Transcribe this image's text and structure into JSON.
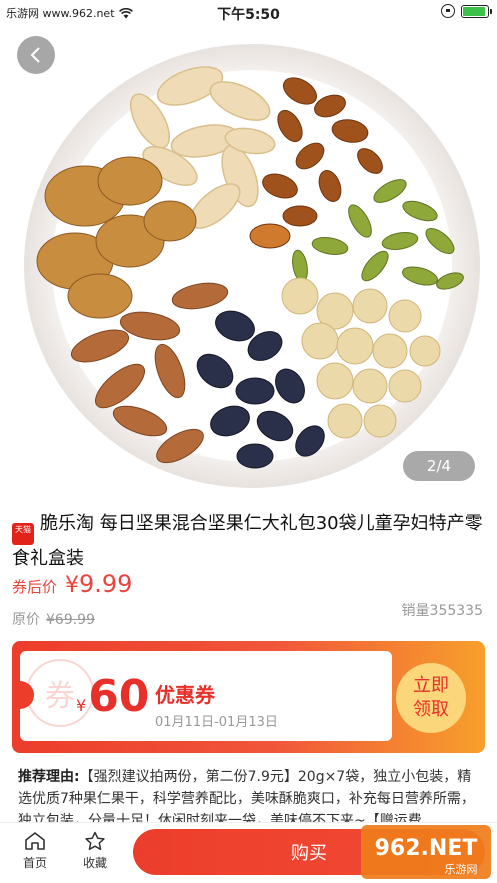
{
  "status_bar": {
    "carrier": "乐游网 www.962.net",
    "time": "下午5:50",
    "battery_level": 0.9
  },
  "gallery": {
    "counter": "2/4"
  },
  "product": {
    "shop_badge": "天猫",
    "title": "脆乐淘 每日坚果混合坚果仁大礼包30袋儿童孕妇特产零食礼盒装",
    "coupon_price_label": "券后价",
    "coupon_price_currency": "¥",
    "coupon_price": "9.99",
    "original_price_label": "原价",
    "original_price": "¥69.99",
    "sales": "销量355335"
  },
  "coupon": {
    "stamp": "券",
    "currency": "¥",
    "value": "60",
    "name": "优惠券",
    "date_range": "01月11日-01月13日",
    "claim_line1": "立即",
    "claim_line2": "领取"
  },
  "recommendation": {
    "label": "推荐理由:",
    "text": "【强烈建议拍两份，第二份7.9元】20g×7袋，独立小包装，精选优质7种果仁果干，科学营养配比，美味酥脆爽口，补充每日营养所需，独立包装，分量十足！休闲时刻来一袋，美味停不下来~【赠运费"
  },
  "bottom_bar": {
    "home_label": "首页",
    "favorite_label": "收藏",
    "buy_label": "购买",
    "watermark_text": "962.NET",
    "watermark_sub": "乐游网"
  },
  "colors": {
    "accent": "#e8453c",
    "coupon_gold": "#fbd67a"
  }
}
